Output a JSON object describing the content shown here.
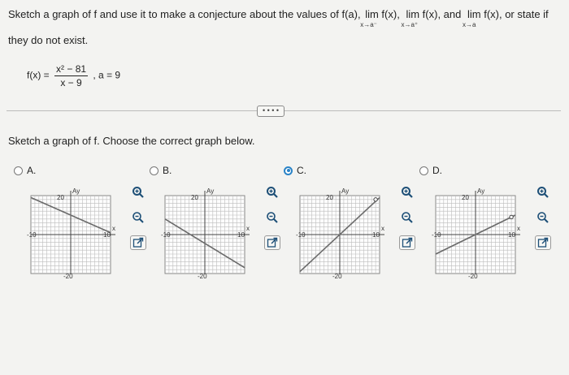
{
  "question": {
    "intro": "Sketch a graph of f and use it to make a conjecture about the values of f(a),",
    "lim1": "lim f(x),",
    "lim1_sub": "x→a⁻",
    "lim2": "lim f(x), and",
    "lim2_sub": "x→a⁺",
    "lim3": "lim f(x), or state if",
    "lim3_sub": "x→a",
    "line2": "they do not exist.",
    "func_lhs": "f(x) =",
    "func_num": "x² − 81",
    "func_den": "x − 9",
    "func_a": ", a = 9"
  },
  "more_button": "• • • •",
  "prompt": "Sketch a graph of f. Choose the correct graph below.",
  "options": [
    {
      "letter": "A.",
      "selected": false
    },
    {
      "letter": "B.",
      "selected": false
    },
    {
      "letter": "C.",
      "selected": true
    },
    {
      "letter": "D.",
      "selected": false
    }
  ],
  "graph_labels": {
    "y": "Ay",
    "x": "x",
    "ytop": "20",
    "ybottom": "-20",
    "xleft": "-10",
    "xright": "10"
  },
  "colors": {
    "selected": "#2a83c7",
    "grid": "#bdbdbd",
    "line": "#6a6a6a",
    "hole": "#ffffff"
  },
  "tool_icons": [
    "zoom-in-icon",
    "zoom-out-icon",
    "open-new-window-icon"
  ]
}
